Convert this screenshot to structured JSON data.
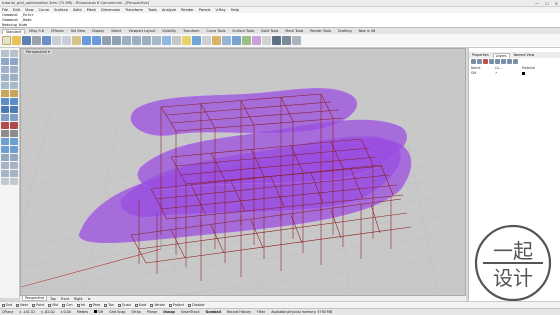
{
  "window": {
    "title": "tutorial_grid_optimization.3dm (72 MB) - Rhinoceros 6 Commercial - [Perspective]",
    "controls": [
      "—",
      "☐",
      "✕"
    ]
  },
  "menu": [
    "File",
    "Edit",
    "View",
    "Curve",
    "Surface",
    "Solid",
    "Mesh",
    "Dimension",
    "Transform",
    "Tools",
    "Analyze",
    "Render",
    "Panels",
    "V-Ray",
    "Help"
  ],
  "command_history": [
    "Command: _Enter",
    "Command: _Redo",
    "Redoing Hide",
    "Command:"
  ],
  "toolbar_tabs": [
    "Standard",
    "VRay 3.6",
    "CPlanes",
    "Set View",
    "Display",
    "Select",
    "Viewport Layout",
    "Visibility",
    "Transform",
    "Curve Tools",
    "Surface Tools",
    "Solid Tools",
    "Mesh Tools",
    "Render Tools",
    "Drafting",
    "New in V6"
  ],
  "viewport": {
    "label": "Perspective ▾"
  },
  "viewport_tabs": [
    "Perspective",
    "Top",
    "Front",
    "Right",
    "⊕"
  ],
  "osnaps": [
    "End",
    "Near",
    "Point",
    "Mid",
    "Cen",
    "Int",
    "Perp",
    "Tan",
    "Quad",
    "Knot",
    "Vertex",
    "Project",
    "Disable"
  ],
  "status": {
    "cplane": "CPlane",
    "x": "x -141.52",
    "y": "y -62.02",
    "z": "z 0.00",
    "units": "Meters",
    "layer": "GH",
    "modes": [
      "Grid Snap",
      "Ortho",
      "Planar",
      "Osnap",
      "SmartTrack",
      "Gumball",
      "Record History",
      "Filter"
    ],
    "memory": "Available physical memory: 3790 MB"
  },
  "panel": {
    "tabs": [
      "Properties",
      "Layers",
      "Named View"
    ],
    "columns": [
      "Name",
      "Cu...",
      "Material"
    ],
    "layer_name": "GH",
    "layer_check": "✓"
  },
  "watermark": {
    "line1": "一起",
    "line2": "设计"
  },
  "colors": {
    "purple_fill": "#9a4ee0",
    "purple_stroke": "#b070f0",
    "frame_red": "#8a1d1d",
    "viewport_bg": "#c8c8c8",
    "grid": "#bdbdbd"
  }
}
